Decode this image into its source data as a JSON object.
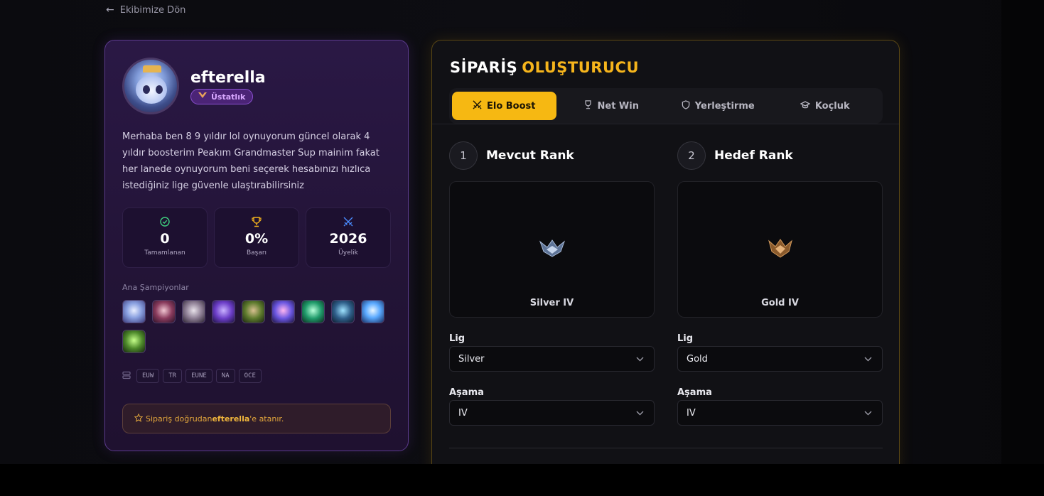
{
  "nav": {
    "back_label": "Ekibimize Dön"
  },
  "profile": {
    "name": "efterella",
    "badge": "Üstatlık",
    "bio": "Merhaba ben 8 9 yıldır lol oynuyorum güncel olarak 4 yıldır boosterim Peakım Grandmaster Sup mainim fakat her lanede oynuyorum beni seçerek hesabınızı hızlıca istediğiniz lige güvenle ulaştırabilirsiniz",
    "stats": [
      {
        "value": "0",
        "label": "Tamamlanan",
        "icon": "check-circle-icon",
        "color": "#3fd27f"
      },
      {
        "value": "0%",
        "label": "Başarı",
        "icon": "trophy-icon",
        "color": "#f2b21c"
      },
      {
        "value": "2026",
        "label": "Üyelik",
        "icon": "swords-icon",
        "color": "#4a8cff"
      }
    ],
    "champions_title": "Ana Şampiyonlar",
    "champions": [
      "champion-1",
      "champion-2",
      "champion-3",
      "champion-4",
      "champion-5",
      "champion-6",
      "champion-7",
      "champion-8",
      "champion-9",
      "champion-10"
    ],
    "regions": [
      "EUW",
      "TR",
      "EUNE",
      "NA",
      "OCE"
    ],
    "assign_prefix": "Sipariş doğrudan ",
    "assign_name": "efterella",
    "assign_suffix": "'e atanır."
  },
  "builder": {
    "title_1": "SİPARİŞ",
    "title_2": "OLUŞTURUCU",
    "tabs": [
      {
        "label": "Elo Boost",
        "icon": "swords-icon",
        "active": true
      },
      {
        "label": "Net Win",
        "icon": "trophy-icon",
        "active": false
      },
      {
        "label": "Yerleştirme",
        "icon": "shield-icon",
        "active": false
      },
      {
        "label": "Koçluk",
        "icon": "graduation-cap-icon",
        "active": false
      }
    ],
    "current": {
      "step": "1",
      "title": "Mevcut Rank",
      "rank_name": "Silver IV",
      "league_label": "Lig",
      "league_value": "Silver",
      "stage_label": "Aşama",
      "stage_value": "IV"
    },
    "target": {
      "step": "2",
      "title": "Hedef Rank",
      "rank_name": "Gold IV",
      "league_label": "Lig",
      "league_value": "Gold",
      "stage_label": "Aşama",
      "stage_value": "IV"
    }
  },
  "colors": {
    "accent": "#f6b812",
    "purple": "#8a4fd0"
  }
}
